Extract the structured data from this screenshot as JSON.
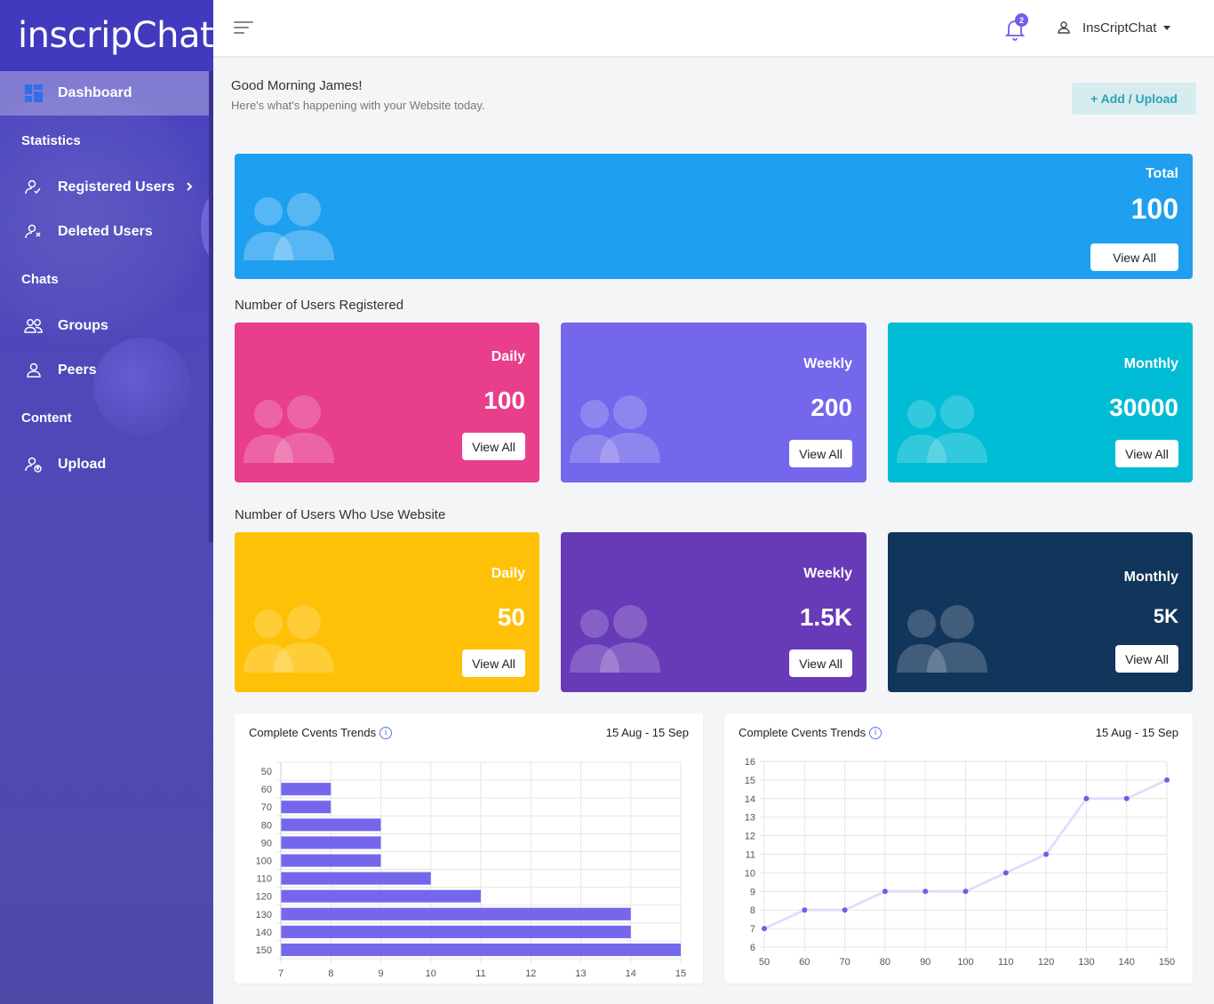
{
  "brand": {
    "name": "inscripChat"
  },
  "sidebar": {
    "items": [
      {
        "key": "dashboard",
        "label": "Dashboard"
      },
      {
        "key": "registered",
        "label": "Registered Users"
      },
      {
        "key": "deleted",
        "label": "Deleted Users"
      },
      {
        "key": "groups",
        "label": "Groups"
      },
      {
        "key": "peers",
        "label": "Peers"
      },
      {
        "key": "upload",
        "label": "Upload"
      }
    ],
    "headings": [
      "Statistics",
      "Chats",
      "Content"
    ]
  },
  "topbar": {
    "notifications_count": "2",
    "user_name": "InsCriptChat"
  },
  "greeting": {
    "title": "Good Morning James!",
    "subtitle": "Here's what's happening with your Website today.",
    "add_button": "+ Add / Upload"
  },
  "total_card": {
    "label": "Total",
    "value": "100",
    "button": "View All",
    "color": "#1e9ff0"
  },
  "registered_section": {
    "title": "Number of Users Registered",
    "cards": [
      {
        "label": "Daily",
        "value": "100",
        "button": "View All",
        "color": "#e83e8c"
      },
      {
        "label": "Weekly",
        "value": "200",
        "button": "View All",
        "color": "#7467ec"
      },
      {
        "label": "Monthly",
        "value": "30000",
        "button": "View All",
        "color": "#00bcd4"
      }
    ]
  },
  "usage_section": {
    "title": "Number of Users Who Use Website",
    "cards": [
      {
        "label": "Daily",
        "value": "50",
        "button": "View All",
        "color": "#fec107"
      },
      {
        "label": "Weekly",
        "value": "1.5K",
        "button": "View All",
        "color": "#673ab7"
      },
      {
        "label": "Monthly",
        "value": "5K",
        "button": "View All",
        "color": "#12355b"
      }
    ]
  },
  "charts": {
    "left": {
      "title": "Complete Cvents Trends",
      "date_range": "15 Aug - 15 Sep"
    },
    "right": {
      "title": "Complete Cvents Trends",
      "date_range": "15 Aug - 15 Sep"
    }
  },
  "chart_data": [
    {
      "type": "bar",
      "orientation": "horizontal",
      "categories": [
        "50",
        "60",
        "70",
        "80",
        "90",
        "100",
        "110",
        "120",
        "130",
        "140",
        "150"
      ],
      "values": [
        null,
        8,
        8,
        9,
        9,
        9,
        10,
        11,
        14,
        14,
        15
      ],
      "xlim": [
        7,
        15
      ],
      "xticks": [
        7,
        8,
        9,
        10,
        11,
        12,
        13,
        14,
        15
      ],
      "color": "#7467ec",
      "grid": true
    },
    {
      "type": "line",
      "x": [
        50,
        60,
        70,
        80,
        90,
        100,
        110,
        120,
        130,
        140,
        150
      ],
      "y": [
        7,
        8,
        8,
        9,
        9,
        9,
        10,
        11,
        14,
        14,
        15
      ],
      "ylim": [
        6,
        16
      ],
      "yticks": [
        6,
        7,
        8,
        9,
        10,
        11,
        12,
        13,
        14,
        15,
        16
      ],
      "line_color": "#e2ddfb",
      "point_color": "#6f5ee8",
      "grid": true
    }
  ]
}
